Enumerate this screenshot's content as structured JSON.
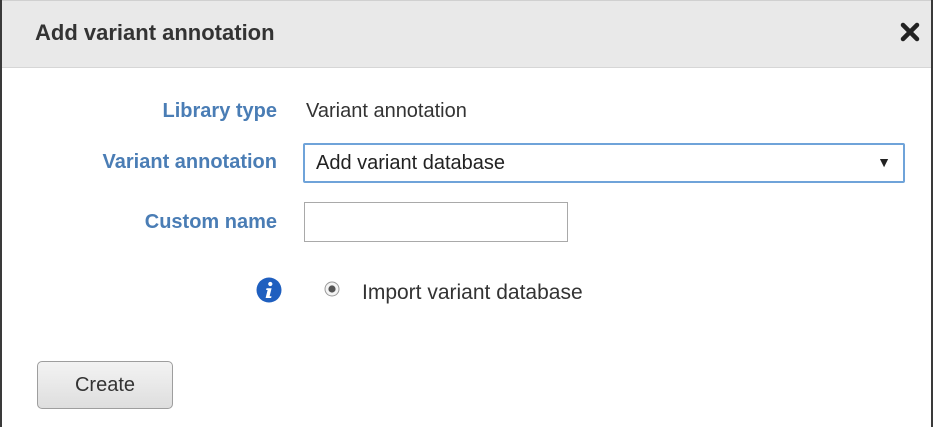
{
  "dialog": {
    "title": "Add variant annotation",
    "close_icon": "close-icon"
  },
  "form": {
    "library_type": {
      "label": "Library type",
      "value": "Variant annotation"
    },
    "variant_annotation": {
      "label": "Variant annotation",
      "selected": "Add variant database",
      "arrow": "▼"
    },
    "custom_name": {
      "label": "Custom name",
      "value": ""
    },
    "info_icon": "info-icon",
    "import_option": {
      "label": "Import variant database",
      "checked": true
    }
  },
  "actions": {
    "create_label": "Create"
  },
  "colors": {
    "label_blue": "#4a7db5",
    "select_border": "#6fa3d9",
    "info_blue": "#1f5fbf",
    "titlebar_bg": "#e9e9e9"
  }
}
